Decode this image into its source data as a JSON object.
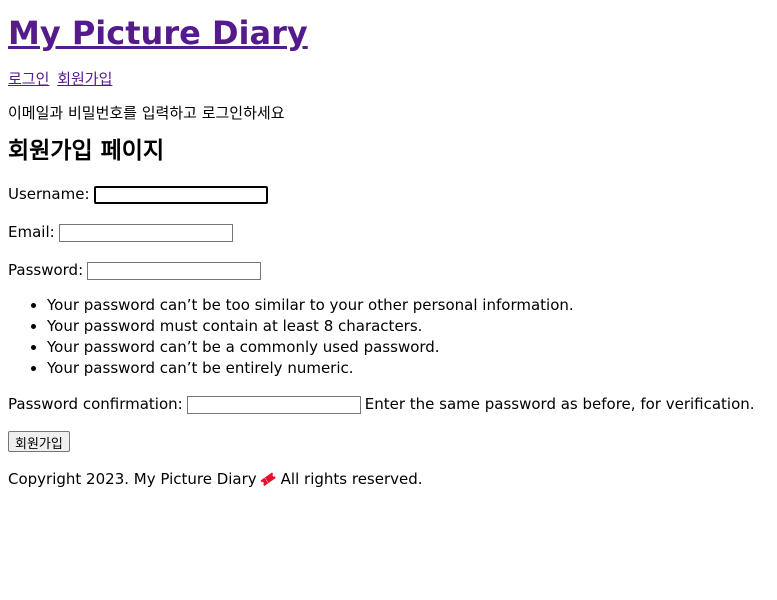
{
  "site": {
    "title": "My Picture Diary"
  },
  "nav": {
    "login": "로그인",
    "signup": "회원가입"
  },
  "notice": "이메일과 비밀번호를 입력하고 로그인하세요",
  "page_title": "회원가입 페이지",
  "form": {
    "username_label": "Username:",
    "username_value": "",
    "email_label": "Email:",
    "email_value": "",
    "password_label": "Password:",
    "password_value": "",
    "password_help": [
      "Your password can’t be too similar to your other personal information.",
      "Your password must contain at least 8 characters.",
      "Your password can’t be a commonly used password.",
      "Your password can’t be entirely numeric."
    ],
    "password2_label": "Password confirmation:",
    "password2_value": "",
    "password2_help": "Enter the same password as before, for verification.",
    "submit_label": "회원가입"
  },
  "footer": {
    "before": "Copyright 2023. My Picture Diary",
    "icon": "ticket-icon",
    "after": "All rights reserved."
  },
  "colors": {
    "link": "#551a8b",
    "icon": "#e8112d"
  }
}
